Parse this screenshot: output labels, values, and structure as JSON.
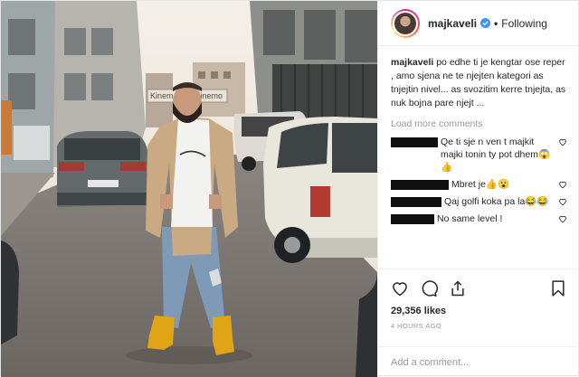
{
  "post": {
    "username": "majkaveli",
    "follow_status": "Following",
    "caption_user": "majkaveli",
    "caption_text": "po edhe ti je kengtar ose reper , amo sjena ne te njejten kategori as tnjejtin nivel... as svozitim kerre tnjejta, as nuk bojna pare njejt ...",
    "load_more": "Load more comments",
    "comments": [
      {
        "text": "Qe ti sje n ven t majkit majki tonin ty pot dhem😱👍"
      },
      {
        "text": "Mbret je👍😮"
      },
      {
        "text": "Qaj golfi koka pa la😂😂"
      },
      {
        "text": "No same level !"
      }
    ],
    "likes": "29,356 likes",
    "time_ago": "4 HOURS AGO",
    "add_comment_placeholder": "Add a comment..."
  },
  "photo": {
    "sign_left": "Kinema",
    "sign_right": "Cinemo"
  },
  "colors": {
    "verified": "#3897f0",
    "coat": "#c9aa83",
    "boots": "#e0a416",
    "jeans": "#7f9ab7"
  }
}
